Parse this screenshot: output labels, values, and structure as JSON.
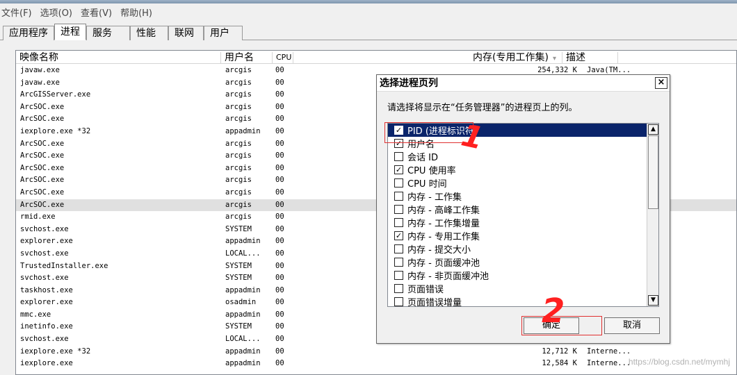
{
  "menu": [
    "文件(F)",
    "选项(O)",
    "查看(V)",
    "帮助(H)"
  ],
  "tabs": [
    "应用程序",
    "进程",
    "服务",
    "性能",
    "联网",
    "用户"
  ],
  "active_tab_index": 1,
  "columns": {
    "image_name": "映像名称",
    "user_name": "用户名",
    "cpu": "CPU",
    "memory": "内存(专用工作集)",
    "sort_indicator": "▾",
    "description": "描述"
  },
  "processes": [
    {
      "name": "javaw.exe",
      "user": "arcgis",
      "cpu": "00",
      "mem": "254,332 K",
      "desc": "Java(TM..."
    },
    {
      "name": "javaw.exe",
      "user": "arcgis",
      "cpu": "00",
      "mem": "",
      "desc": ""
    },
    {
      "name": "ArcGISServer.exe",
      "user": "arcgis",
      "cpu": "00",
      "mem": "",
      "desc": ""
    },
    {
      "name": "ArcSOC.exe",
      "user": "arcgis",
      "cpu": "00",
      "mem": "",
      "desc": ""
    },
    {
      "name": "ArcSOC.exe",
      "user": "arcgis",
      "cpu": "00",
      "mem": "",
      "desc": ""
    },
    {
      "name": "iexplore.exe *32",
      "user": "appadmin",
      "cpu": "00",
      "mem": "",
      "desc": ""
    },
    {
      "name": "ArcSOC.exe",
      "user": "arcgis",
      "cpu": "00",
      "mem": "",
      "desc": ""
    },
    {
      "name": "ArcSOC.exe",
      "user": "arcgis",
      "cpu": "00",
      "mem": "",
      "desc": ""
    },
    {
      "name": "ArcSOC.exe",
      "user": "arcgis",
      "cpu": "00",
      "mem": "",
      "desc": ""
    },
    {
      "name": "ArcSOC.exe",
      "user": "arcgis",
      "cpu": "00",
      "mem": "",
      "desc": ""
    },
    {
      "name": "ArcSOC.exe",
      "user": "arcgis",
      "cpu": "00",
      "mem": "",
      "desc": ""
    },
    {
      "name": "ArcSOC.exe",
      "user": "arcgis",
      "cpu": "00",
      "mem": "",
      "desc": "",
      "selected": true
    },
    {
      "name": "rmid.exe",
      "user": "arcgis",
      "cpu": "00",
      "mem": "",
      "desc": ""
    },
    {
      "name": "svchost.exe",
      "user": "SYSTEM",
      "cpu": "00",
      "mem": "",
      "desc": ""
    },
    {
      "name": "explorer.exe",
      "user": "appadmin",
      "cpu": "00",
      "mem": "",
      "desc": ""
    },
    {
      "name": "svchost.exe",
      "user": "LOCAL...",
      "cpu": "00",
      "mem": "",
      "desc": ""
    },
    {
      "name": "TrustedInstaller.exe",
      "user": "SYSTEM",
      "cpu": "00",
      "mem": "",
      "desc": ""
    },
    {
      "name": "svchost.exe",
      "user": "SYSTEM",
      "cpu": "00",
      "mem": "",
      "desc": ""
    },
    {
      "name": "taskhost.exe",
      "user": "appadmin",
      "cpu": "00",
      "mem": "",
      "desc": ""
    },
    {
      "name": "explorer.exe",
      "user": "osadmin",
      "cpu": "00",
      "mem": "",
      "desc": ""
    },
    {
      "name": "mmc.exe",
      "user": "appadmin",
      "cpu": "00",
      "mem": "",
      "desc": ""
    },
    {
      "name": "inetinfo.exe",
      "user": "SYSTEM",
      "cpu": "00",
      "mem": "",
      "desc": ""
    },
    {
      "name": "svchost.exe",
      "user": "LOCAL...",
      "cpu": "00",
      "mem": "",
      "desc": ""
    },
    {
      "name": "iexplore.exe *32",
      "user": "appadmin",
      "cpu": "00",
      "mem": "12,712 K",
      "desc": "Interne..."
    },
    {
      "name": "iexplore.exe",
      "user": "appadmin",
      "cpu": "00",
      "mem": "12,584 K",
      "desc": "Interne..."
    }
  ],
  "dialog": {
    "title": "选择进程页列",
    "close": "×",
    "instruction": "请选择将显示在“任务管理器”的进程页上的列。",
    "items": [
      {
        "label": "PID (进程标识符)",
        "checked": true,
        "highlighted": true
      },
      {
        "label": "用户名",
        "checked": true
      },
      {
        "label": "会话 ID",
        "checked": false
      },
      {
        "label": "CPU 使用率",
        "checked": true
      },
      {
        "label": "CPU 时间",
        "checked": false
      },
      {
        "label": "内存 - 工作集",
        "checked": false
      },
      {
        "label": "内存 - 高峰工作集",
        "checked": false
      },
      {
        "label": "内存 - 工作集增量",
        "checked": false
      },
      {
        "label": "内存 - 专用工作集",
        "checked": true
      },
      {
        "label": "内存 - 提交大小",
        "checked": false
      },
      {
        "label": "内存 - 页面缓冲池",
        "checked": false
      },
      {
        "label": "内存 - 非页面缓冲池",
        "checked": false
      },
      {
        "label": "页面错误",
        "checked": false
      },
      {
        "label": "页面错误增量",
        "checked": false
      }
    ],
    "ok": "确定",
    "cancel": "取消",
    "check_glyph": "✓",
    "scroll_up": "▲",
    "scroll_down": "▼"
  },
  "annotations": {
    "one": "1",
    "two": "2",
    "color": "#ff2020"
  },
  "watermark": "https://blog.csdn.net/mymhj"
}
